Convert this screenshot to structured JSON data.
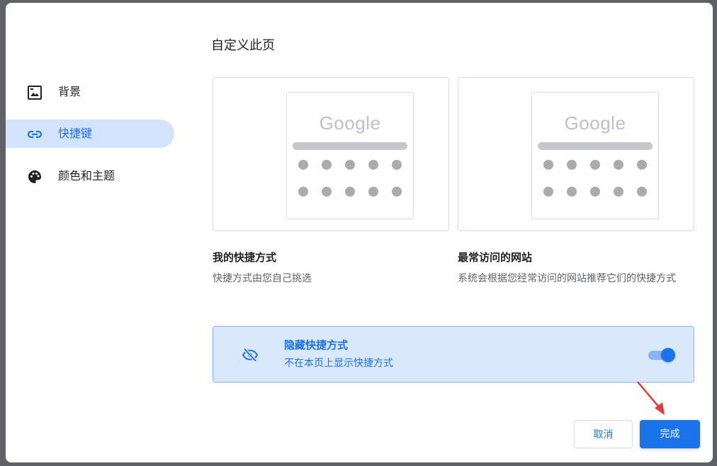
{
  "dialog": {
    "title": "自定义此页"
  },
  "sidebar": {
    "items": [
      {
        "label": "背景",
        "icon": "image-icon",
        "active": false
      },
      {
        "label": "快捷键",
        "icon": "link-icon",
        "active": true
      },
      {
        "label": "颜色和主题",
        "icon": "palette-icon",
        "active": false
      }
    ]
  },
  "options": [
    {
      "preview_logo": "Google",
      "title": "我的快捷方式",
      "description": "快捷方式由您自己挑选"
    },
    {
      "preview_logo": "Google",
      "title": "最常访问的网站",
      "description": "系统会根据您经常访问的网站推荐它们的快捷方式"
    }
  ],
  "hide_shortcuts": {
    "title": "隐藏快捷方式",
    "description": "不在本页上显示快捷方式",
    "icon": "eye-off-icon",
    "enabled": true
  },
  "buttons": {
    "cancel_label": "取消",
    "done_label": "完成"
  },
  "colors": {
    "accent": "#1a73e8",
    "active_nav_bg": "#d3e3fd",
    "panel_bg": "#dbe8fb",
    "annotation_arrow": "#e53935"
  }
}
